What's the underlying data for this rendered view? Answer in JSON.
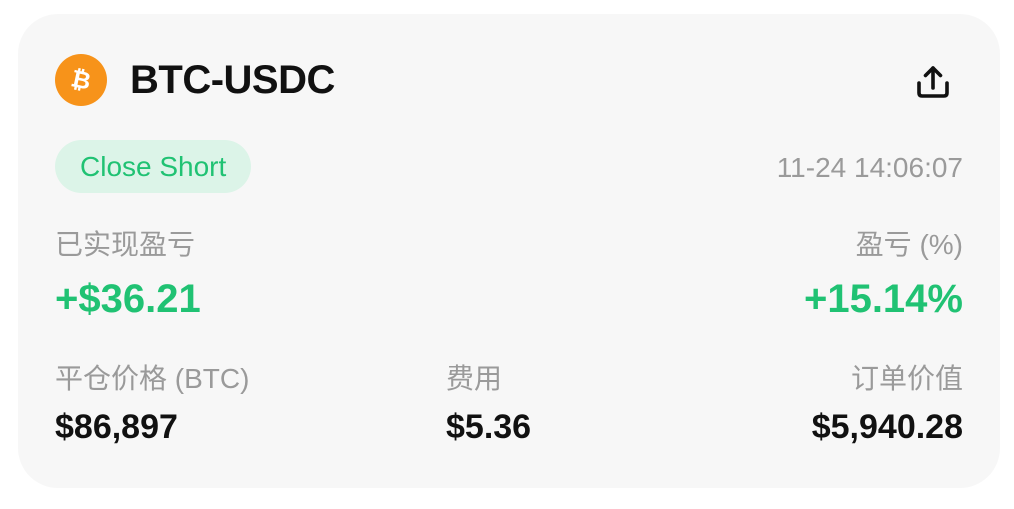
{
  "header": {
    "pair": "BTC-USDC",
    "coin_icon": "bitcoin-icon",
    "coin_color": "#f7931a",
    "share_icon": "share-upload-icon"
  },
  "order": {
    "type_tag": "Close Short",
    "timestamp": "11-24 14:06:07"
  },
  "pnl": {
    "realized_label": "已实现盈亏",
    "realized_value": "+$36.21",
    "percent_label": "盈亏 (%)",
    "percent_value": "+15.14%"
  },
  "details": {
    "close_price_label": "平仓价格 (BTC)",
    "close_price_value": "$86,897",
    "fee_label": "费用",
    "fee_value": "$5.36",
    "order_value_label": "订单价值",
    "order_value_value": "$5,940.28"
  },
  "colors": {
    "positive": "#20c273",
    "tag_bg": "#dcf4e8",
    "muted": "#9a9a9a",
    "card_bg": "#f7f7f7"
  }
}
